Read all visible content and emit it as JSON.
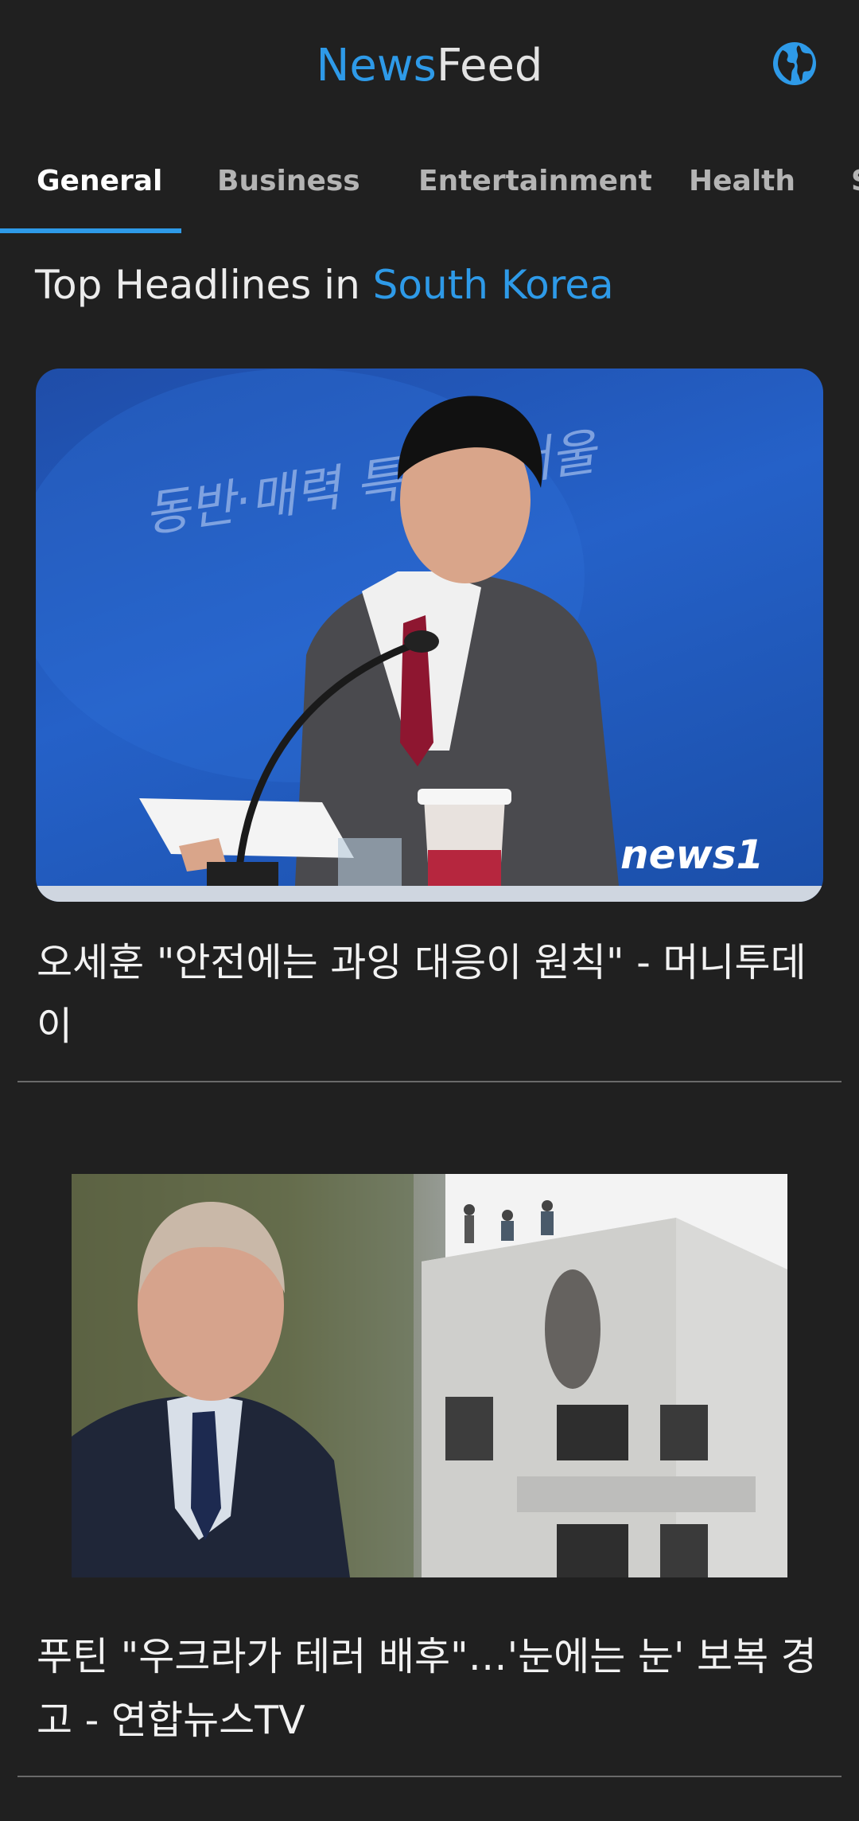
{
  "app": {
    "logo_part1": "News",
    "logo_part2": "Feed",
    "accent_color": "#2e9ae8",
    "background_color": "#202020",
    "country_icon": "globe-icon"
  },
  "tabs": [
    {
      "label": "General",
      "active": true
    },
    {
      "label": "Business",
      "active": false
    },
    {
      "label": "Entertainment",
      "active": false
    },
    {
      "label": "Health",
      "active": false
    },
    {
      "label": "S",
      "active": false
    }
  ],
  "section": {
    "prefix": "Top Headlines in ",
    "country": "South Korea"
  },
  "articles": [
    {
      "title": "오세훈 \"안전에는 과잉 대응이 원칙\" - 머니투데이",
      "image_watermark": "news1",
      "image_backdrop_text": "동반·매력 특별시 서울"
    },
    {
      "title": "푸틴 \"우크라가 테러 배후\"…'눈에는 눈' 보복 경고 - 연합뉴스TV"
    }
  ]
}
